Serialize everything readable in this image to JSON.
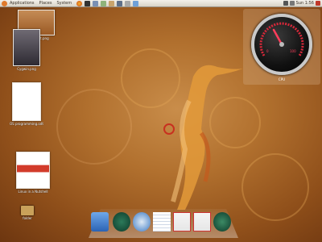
{
  "panel": {
    "menus": [
      "Applications",
      "Places",
      "System"
    ],
    "clock": "Sun 1:56"
  },
  "desktop_icons": [
    {
      "name": "screenshot-file",
      "label": "Screenshot.png"
    },
    {
      "name": "book-file-1",
      "label": "Cygwin.png"
    },
    {
      "name": "document-file",
      "label": "OS programming.odt"
    },
    {
      "name": "book-file-2",
      "label": "Linux in a Nutshell"
    },
    {
      "name": "folder",
      "label": "folder"
    }
  ],
  "gauge": {
    "label": "CPU",
    "min_label": "0",
    "max_label": "100"
  },
  "dock": {
    "items": [
      "finder-icon",
      "clock-icon",
      "safari-icon",
      "notepad-icon",
      "mail-icon",
      "refresh-icon"
    ]
  }
}
